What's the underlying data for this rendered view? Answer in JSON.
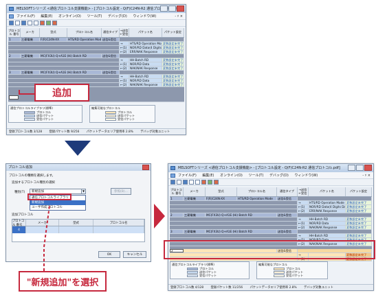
{
  "win1": {
    "title": "MELSOFTシリーズ <通信プロトコル支援機能> - [プロトコル設定 - Q(F)C24N-R2 通信プロトコル.pdf]",
    "menu": [
      "ファイル(F)",
      "編集(E)",
      "オンライン(O)",
      "ツール(T)",
      "デバッグ(D)",
      "ウィンドウ(W)"
    ],
    "menu_right": "- ♯ ×",
    "headers": [
      "プロトコル\n番号",
      "メーカ",
      "型式",
      "プロトコル名",
      "通信タイプ",
      "→送信\n←受信",
      "パケット名",
      "パケット設定"
    ],
    "rows": [
      {
        "num": "1",
        "maker": "三菱電機",
        "model": "F(R)C24N-XX",
        "proto": "HTS/RD Operation Mode",
        "type": "送信&受信"
      },
      {
        "dir": "→",
        "name": "HTS/RD Operation Mode",
        "set": "変数設定未完了"
      },
      {
        "dir": "←(1)",
        "name": "NOR/RD Data(4 Digits Data)",
        "set": "変数設定未完了"
      },
      {
        "dir": "←(2)",
        "name": "ERR/NAK Response",
        "set": "変数設定未完了"
      },
      {
        "num": "2",
        "maker": "三菱電機",
        "model": "MC(FX3U) Q+A1E (Hi) Batch RD",
        "proto": "",
        "type": "送信&受信"
      },
      {
        "dir": "→",
        "name": "HH-Batch RD",
        "set": "変数設定未完了"
      },
      {
        "dir": "←(1)",
        "name": "NOR/RD Data",
        "set": "変数設定未完了"
      },
      {
        "dir": "←(2)",
        "name": "NAK/NAK Response",
        "set": "変数設定未完了"
      },
      {
        "num": "3",
        "maker": "三菱電機",
        "model": "MC(FX3U) Q+A1E (Hi) Batch RD",
        "proto": "",
        "type": "送信&受信"
      },
      {
        "dir": "→",
        "name": "HH-Batch RD",
        "set": "変数設定未完了"
      },
      {
        "dir": "←(1)",
        "name": "NOR/RD Data",
        "set": "変数設定未完了"
      },
      {
        "dir": "←(2)",
        "name": "NAK/NAK Response",
        "set": "変数設定未完了"
      }
    ],
    "legend_left_title": "通信プロトコルライブラリ(標準)",
    "legend_left": [
      "プロトコル",
      "送信パケット",
      "受信パケット"
    ],
    "legend_right_title": "編集可能なプロトコル",
    "legend_right": [
      "プロトコル",
      "送信パケット",
      "受信パケット"
    ],
    "status": [
      "登録プロトコル数 3/128",
      "登録パケット数 9/256",
      "パケットデータエリア使用率 2.8%",
      "デバッグ対象ユニット"
    ]
  },
  "callout1": "追加",
  "dialog": {
    "title": "プロトコル追加",
    "prompt": "プロトコルの種類を選択します。",
    "section1": "追加するプロトコル種別の選択",
    "type_label": "種別(T)",
    "combo_value": "新規追加",
    "combo_list": [
      "通信プロトコルライブラリ",
      "新規追加",
      "ユーザ作成プロトコル"
    ],
    "ref_button": "参照(B)...",
    "section2": "追加プロトコル",
    "cols": [
      "プロトコル\n番号",
      "メーカ",
      "型式",
      "プロトコル名"
    ],
    "row_num": "4",
    "ok": "OK",
    "cancel": "キャンセル"
  },
  "callout2": "\"新規追加\"を選択",
  "win2": {
    "title": "MELSOFTシリーズ <通信プロトコル支援機能> - [プロトコル設定 - Q(F)C24N-R2 通信プロトコル.pdf]",
    "menu": [
      "ファイル(F)",
      "編集(E)",
      "オンライン(O)",
      "ツール(T)",
      "デバッグ(D)",
      "ウィンドウ(W)"
    ],
    "menu_right": "- ♯ ×",
    "new_row": {
      "num": "4",
      "type": "送信&受信",
      "dir_send": "→",
      "dir_recv": "←(1)",
      "set": "変数設定未完了"
    },
    "status": [
      "登録プロトコル数 4/128",
      "登録パケット数 11/256",
      "パケットデータエリア使用率 2.8%",
      "デバッグ対象ユニット"
    ]
  },
  "colors": {
    "accent_red": "#c6283d",
    "arrow_blue": "#1e3a7a",
    "protocol_row": "#a9b8d6",
    "highlight_row": "#fde6b8"
  }
}
